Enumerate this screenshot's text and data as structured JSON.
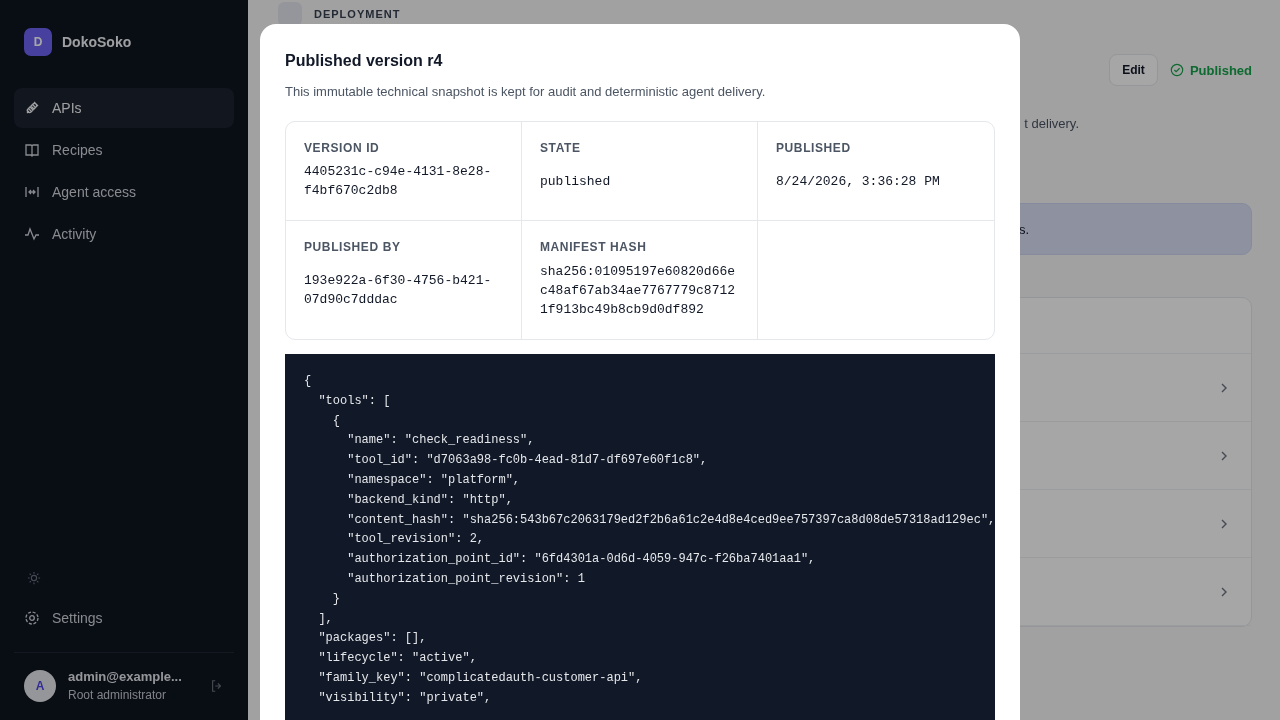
{
  "sidebar": {
    "brand": {
      "initial": "D",
      "name": "DokoSoko"
    },
    "items": [
      {
        "label": "APIs",
        "selected": true
      },
      {
        "label": "Recipes",
        "selected": false
      },
      {
        "label": "Agent access",
        "selected": false
      },
      {
        "label": "Activity",
        "selected": false
      }
    ],
    "settings": "Settings",
    "user": {
      "initial": "A",
      "email": "admin@example...",
      "role": "Root administrator"
    }
  },
  "page": {
    "breadcrumb": "DEPLOYMENT",
    "edit_button": "Edit",
    "status": "Published",
    "description_tail": "t delivery.",
    "notice_tail": "s.",
    "list_rows": [
      {
        "kind": "link"
      },
      {
        "kind": "link"
      },
      {
        "kind": "link"
      },
      {
        "kind": "link"
      }
    ]
  },
  "modal": {
    "title": "Published version r4",
    "description": "This immutable technical snapshot is kept for audit and deterministic agent delivery.",
    "details": [
      {
        "label": "VERSION ID",
        "value": "4405231c-c94e-4131-8e28-f4bf670c2db8"
      },
      {
        "label": "STATE",
        "value": "published"
      },
      {
        "label": "PUBLISHED",
        "value": "8/24/2026, 3:36:28 PM"
      },
      {
        "label": "PUBLISHED BY",
        "value": "193e922a-6f30-4756-b421-07d90c7dddac"
      },
      {
        "label": "MANIFEST HASH",
        "value": "sha256:01095197e60820d66ec48af67ab34ae7767779c87121f913bc49b8cb9d0df892"
      }
    ],
    "code_lines": [
      "{",
      "  \"tools\": [",
      "    {",
      "      \"name\": \"check_readiness\",",
      "      \"tool_id\": \"d7063a98-fc0b-4ead-81d7-df697e60f1c8\",",
      "      \"namespace\": \"platform\",",
      "      \"backend_kind\": \"http\",",
      "      \"content_hash\": \"sha256:543b67c2063179ed2f2b6a61c2e4d8e4ced9ee757397ca8d08de57318ad129ec\",",
      "      \"tool_revision\": 2,",
      "      \"authorization_point_id\": \"6fd4301a-0d6d-4059-947c-f26ba7401aa1\",",
      "      \"authorization_point_revision\": 1",
      "    }",
      "  ],",
      "  \"packages\": [],",
      "  \"lifecycle\": \"active\",",
      "  \"family_key\": \"complicatedauth-customer-api\",",
      "  \"visibility\": \"private\","
    ]
  }
}
